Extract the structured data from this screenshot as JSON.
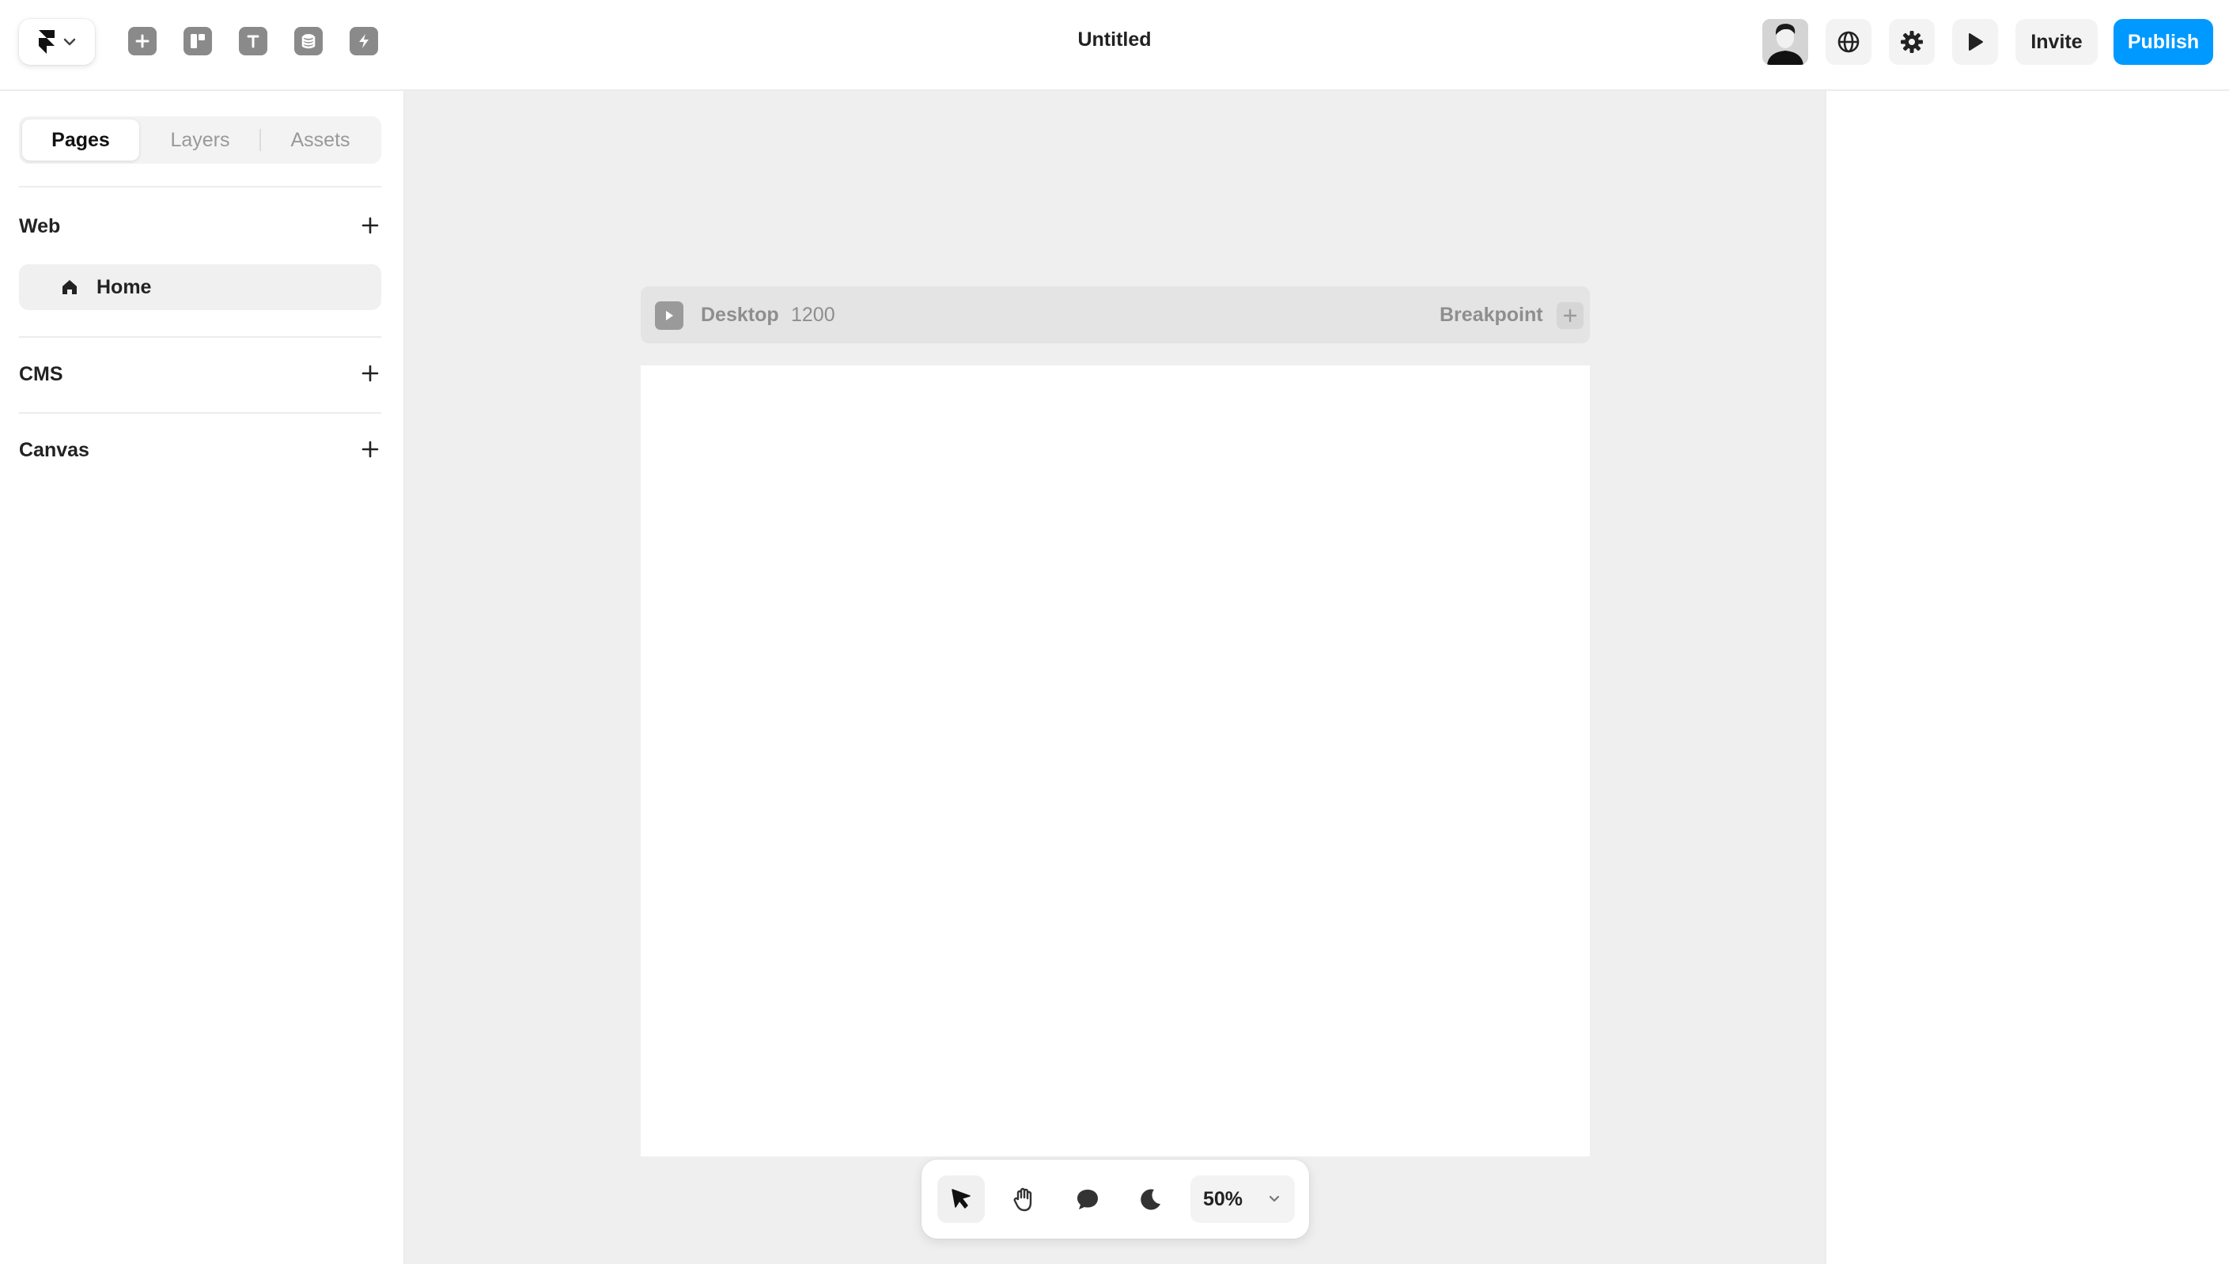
{
  "app": {
    "title": "Untitled"
  },
  "topbar": {
    "logo_icon": "framer-logo-icon",
    "tools": [
      {
        "name": "insert-icon"
      },
      {
        "name": "layout-icon"
      },
      {
        "name": "text-icon"
      },
      {
        "name": "cms-database-icon"
      },
      {
        "name": "interactions-bolt-icon"
      }
    ],
    "right_icons": [
      "globe-icon",
      "gear-icon",
      "play-icon"
    ],
    "invite_label": "Invite",
    "publish_label": "Publish",
    "colors": {
      "publish": "#0099ff"
    }
  },
  "sidebar": {
    "tabs": [
      {
        "label": "Pages",
        "active": true
      },
      {
        "label": "Layers",
        "active": false
      },
      {
        "label": "Assets",
        "active": false
      }
    ],
    "sections": {
      "web": {
        "title": "Web",
        "pages": [
          {
            "label": "Home",
            "icon": "home-icon"
          }
        ]
      },
      "cms": {
        "title": "CMS"
      },
      "canvas": {
        "title": "Canvas"
      }
    }
  },
  "canvas": {
    "breakpoint": {
      "name": "Desktop",
      "width": "1200",
      "add_label": "Breakpoint"
    },
    "toolbar": {
      "tools": [
        "select-arrow-icon",
        "hand-icon",
        "comment-icon",
        "dark-mode-moon-icon"
      ],
      "zoom": "50%"
    }
  }
}
